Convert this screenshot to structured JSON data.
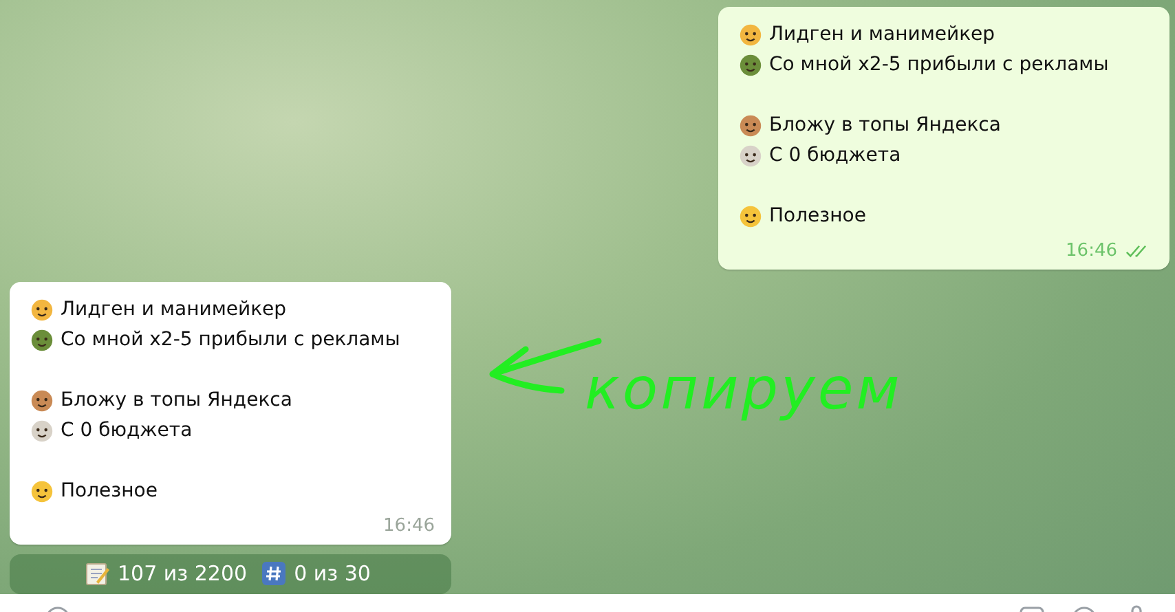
{
  "messages": [
    {
      "kind": "outgoing",
      "paragraphs": [
        [
          "Лидген и манимейкер",
          "Со мной x2-5 прибыли с рекламы"
        ],
        [
          "Бложу в топы Яндекса",
          "С 0 бюджета"
        ],
        [
          "Полезное"
        ]
      ],
      "time": "16:46",
      "read": true
    },
    {
      "kind": "incoming",
      "paragraphs": [
        [
          "Лидген и манимейкер",
          "Со мной x2-5 прибыли с рекламы"
        ],
        [
          "Бложу в топы Яндекса",
          "С 0 бюджета"
        ],
        [
          "Полезное"
        ]
      ],
      "time": "16:46"
    }
  ],
  "counter": {
    "chars": "107 из 2200",
    "tags": "0 из 30"
  },
  "annotation": {
    "text": "копируем"
  }
}
